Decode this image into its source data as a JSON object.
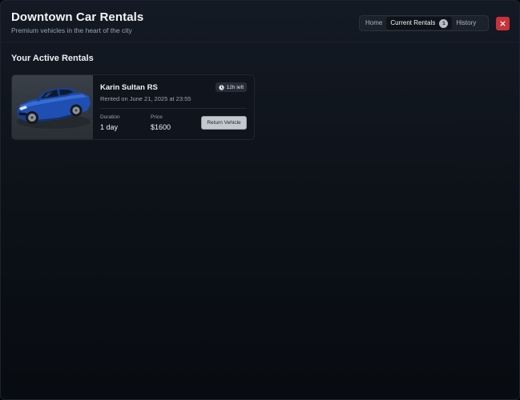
{
  "header": {
    "title": "Downtown Car Rentals",
    "subtitle": "Premium vehicles in the heart of the city"
  },
  "nav": {
    "tabs": [
      {
        "label": "Home",
        "active": false
      },
      {
        "label": "Current Rentals",
        "active": true,
        "count": "1"
      },
      {
        "label": "History",
        "active": false
      }
    ]
  },
  "close_icon": "close-icon",
  "main": {
    "section_title": "Your Active Rentals",
    "rental": {
      "car_name": "Karin Sultan RS",
      "rented_on": "Rented on June 21, 2025 at 23:55",
      "time_left": "12h left",
      "duration_label": "Duration",
      "duration_value": "1 day",
      "price_label": "Price",
      "price_value": "$1600",
      "return_label": "Return Vehicle",
      "image_icon": "car-image"
    }
  },
  "colors": {
    "accent_red": "#c8323a",
    "background": "#0c1118",
    "card": "#10151d",
    "car_blue": "#1f4fb3"
  }
}
